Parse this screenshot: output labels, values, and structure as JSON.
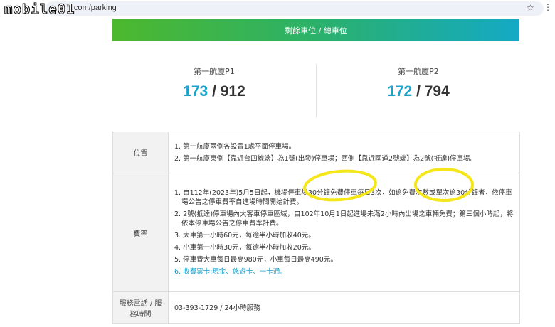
{
  "browser": {
    "url_visible": "t         rt.com/parking",
    "star_icon": "star-icon",
    "menu_icon": "kebab-menu-icon"
  },
  "watermark": "mobile01",
  "banner": {
    "title": "剩餘車位 / 總車位"
  },
  "lots": [
    {
      "name": "第一航廈P1",
      "available": "173",
      "sep": " / ",
      "total": "912"
    },
    {
      "name": "第一航廈P2",
      "available": "172",
      "sep": " / ",
      "total": "794"
    }
  ],
  "table": {
    "location": {
      "label": "位置",
      "items": [
        "1. 第一航廈兩側各設置1處平面停車場。",
        "2. 第一航廈東側【靠近台四線端】為1號(出發)停車場；西側【靠近國道2號端】為2號(抵達)停車場。"
      ]
    },
    "rates": {
      "label": "費率",
      "items": [
        "1. 自112年(2023年)5月5日起，機場停車場30分鐘免費停車每日3次，如逾免費次數或單次逾30分鐘者，依停車場公告之停車費率自進場時間開始計費。",
        "2. 2號(抵達)停車場內大客車停車區域，自102年10月1日起進場未滿2小時內出場之車輛免費；第三個小時起，將依本停車場公告之停車費率計費。",
        "3. 大車第一小時60元，每逾半小時加收40元。",
        "4. 小車第一小時30元，每逾半小時加收20元。",
        "5. 停車費大車每日最高980元，小車每日最高490元。",
        "6. 收費票卡:現金、悠遊卡、一卡通。"
      ]
    },
    "service": {
      "label": "服務電話 / 服務時間",
      "value": "03-393-1729 / 24小時服務"
    }
  },
  "colors": {
    "accent": "#1aa3cb",
    "banner_start": "#4db82d",
    "banner_end": "#14a9c6",
    "highlight": "#f5e61a"
  }
}
